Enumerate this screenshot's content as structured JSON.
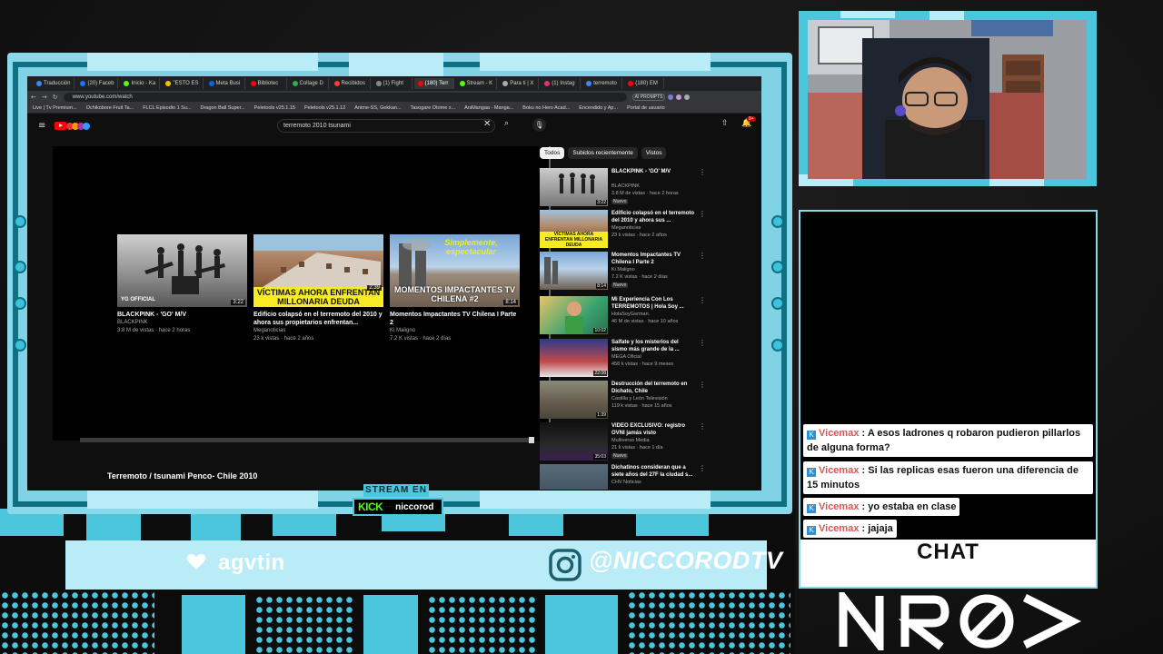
{
  "browser": {
    "tabs": [
      {
        "label": "Traducción",
        "color": "#4285f4"
      },
      {
        "label": "(20) Faceb",
        "color": "#1877f2"
      },
      {
        "label": "Inicio - Ka",
        "color": "#53fc18"
      },
      {
        "label": "\"ESTO ES",
        "color": "#fbbc04"
      },
      {
        "label": "Meta Busi",
        "color": "#0668e1"
      },
      {
        "label": "Bibliotec",
        "color": "#ff0000"
      },
      {
        "label": "Collage D",
        "color": "#34a853"
      },
      {
        "label": "Recibidos",
        "color": "#ea4335"
      },
      {
        "label": "(1) Fight",
        "color": "#888888"
      },
      {
        "label": "(180) Terr",
        "color": "#ff0000"
      },
      {
        "label": "Stream - K",
        "color": "#53fc18"
      },
      {
        "label": "Para ti | X",
        "color": "#aaaaaa"
      },
      {
        "label": "(1) Instag",
        "color": "#e1306c"
      },
      {
        "label": "terremoto",
        "color": "#4285f4"
      },
      {
        "label": "(180) EM",
        "color": "#ff0000"
      }
    ],
    "active_tab_index": 9,
    "url": "www.youtube.com/watch",
    "addr_chip": "AI PROMPTS",
    "nav_back": "←",
    "nav_fwd": "→",
    "nav_reload": "↻",
    "bookmarks": [
      "Live | Tv Premium...",
      "Ochikobore Fruit Ta...",
      "FLCL Episodio 1 Su...",
      "Dragon Ball Super...",
      "Peletools v25.1.15",
      "Peletools v25.1.12",
      "Anime-SS, Gekkan...",
      "Tasogare Otome x...",
      "AniMangaa - Manga...",
      "Boku no Hero Acad...",
      "Encendido y Ap...",
      "Portal de usuario"
    ]
  },
  "youtube": {
    "menu_icon": "≡",
    "search_query": "terremoto 2010 tsunami",
    "clear_icon": "✕",
    "search_icon": "⌕",
    "mic_icon": "🎙",
    "upload_icon": "⇧",
    "bell_icon": "🔔",
    "bell_badge": "9+",
    "video_title": "Terremoto / tsunami Penco- Chile 2010",
    "end_cards": [
      {
        "title": "BLACKPINK - 'GO' M/V",
        "channel": "BLACKPINK",
        "meta": "3.8 M de vistas · hace 2 horas",
        "duration": "3:22",
        "caption": "YG OFFICIAL"
      },
      {
        "title": "Edificio colapsó en el terremoto del 2010 y ahora sus propietarios enfrentan...",
        "channel": "Meganoticias",
        "meta": "23 k vistas · hace 2 años",
        "duration": "2:39",
        "caption": "VÍCTIMAS AHORA ENFRENTAN MILLONARIA DEUDA"
      },
      {
        "title": "Momentos Impactantes TV Chilena I Parte 2",
        "channel": "Ki Maligno",
        "meta": "7.2 K vistas · hace 2 días",
        "duration": "8:14",
        "caption": "MOMENTOS IMPACTANTES TV CHILENA #2",
        "caption2": "Simplemente, espectacular"
      }
    ],
    "chips": [
      "Todos",
      "Subidos recientemente",
      "Vistos"
    ],
    "recommendations": [
      {
        "title": "BLACKPINK - 'GO' M/V",
        "channel": "BLACKPINK",
        "meta": "3.8 M de vistas · hace 2 horas",
        "duration": "3:22",
        "badge": "Nuevo"
      },
      {
        "title": "Edificio colapsó en el terremoto del 2010 y ahora sus ...",
        "channel": "Meganoticias",
        "meta": "23 k vistas · hace 2 años",
        "duration": "",
        "badge": ""
      },
      {
        "title": "Momentos Impactantes TV Chilena I Parte 2",
        "channel": "Ki Maligno",
        "meta": "7.2 K vistas · hace 2 días",
        "duration": "8:14",
        "badge": "Nuevo"
      },
      {
        "title": "Mi Experiencia Con Los TERREMOTOS | Hola Soy ...",
        "channel": "HolaSoyGerman.",
        "meta": "46 M de vistas · hace 10 años",
        "duration": "10:02",
        "badge": ""
      },
      {
        "title": "Salfate y los misterios del sismo más grande de la ...",
        "channel": "MEGA Oficial",
        "meta": "458 k vistas · hace 9 meses",
        "duration": "22:08",
        "badge": ""
      },
      {
        "title": "Destrucción del terremoto en Dichato, Chile",
        "channel": "Castilla y León Televisión",
        "meta": "119 k vistas · hace 15 años",
        "duration": "1:39",
        "badge": ""
      },
      {
        "title": "VIDEO EXCLUSIVO: registro OVNI jamás visto",
        "channel": "Multiverso Media",
        "meta": "21 k vistas · hace 1 día",
        "duration": "35:03",
        "badge": "Nuevo"
      },
      {
        "title": "Dichatinos consideran que a siete años del 27F la ciudad s...",
        "channel": "CHV Noticias",
        "meta": "",
        "duration": "",
        "badge": ""
      }
    ],
    "more_icon": "⋮"
  },
  "overlay": {
    "stream_en": "STREAM EN",
    "kick_logo": "KICK",
    "kick_sep": "· · ·",
    "kick_user": "niccorod",
    "donor_name": "agvtin",
    "instagram_handle": "@NICCORODTV",
    "chat_title": "CHAT",
    "brand": "NRØ>"
  },
  "chat": {
    "messages": [
      {
        "user": "Vicemax",
        "text": ": A esos ladrones q robaron pudieron pillarlos de alguna forma?"
      },
      {
        "user": "Vicemax",
        "text": ": Si las replicas esas fueron una diferencia de 15 minutos"
      },
      {
        "user": "Vicemax",
        "text": ": yo estaba en clase"
      },
      {
        "user": "Vicemax",
        "text": ": jajaja"
      }
    ]
  },
  "colors": {
    "accent": "#4cc6dd",
    "accent_light": "#b9ecf6",
    "frame_dark": "#0f6f83",
    "kick_green": "#53fc18",
    "youtube_red": "#ff0000",
    "chat_user": "#d8555a"
  }
}
